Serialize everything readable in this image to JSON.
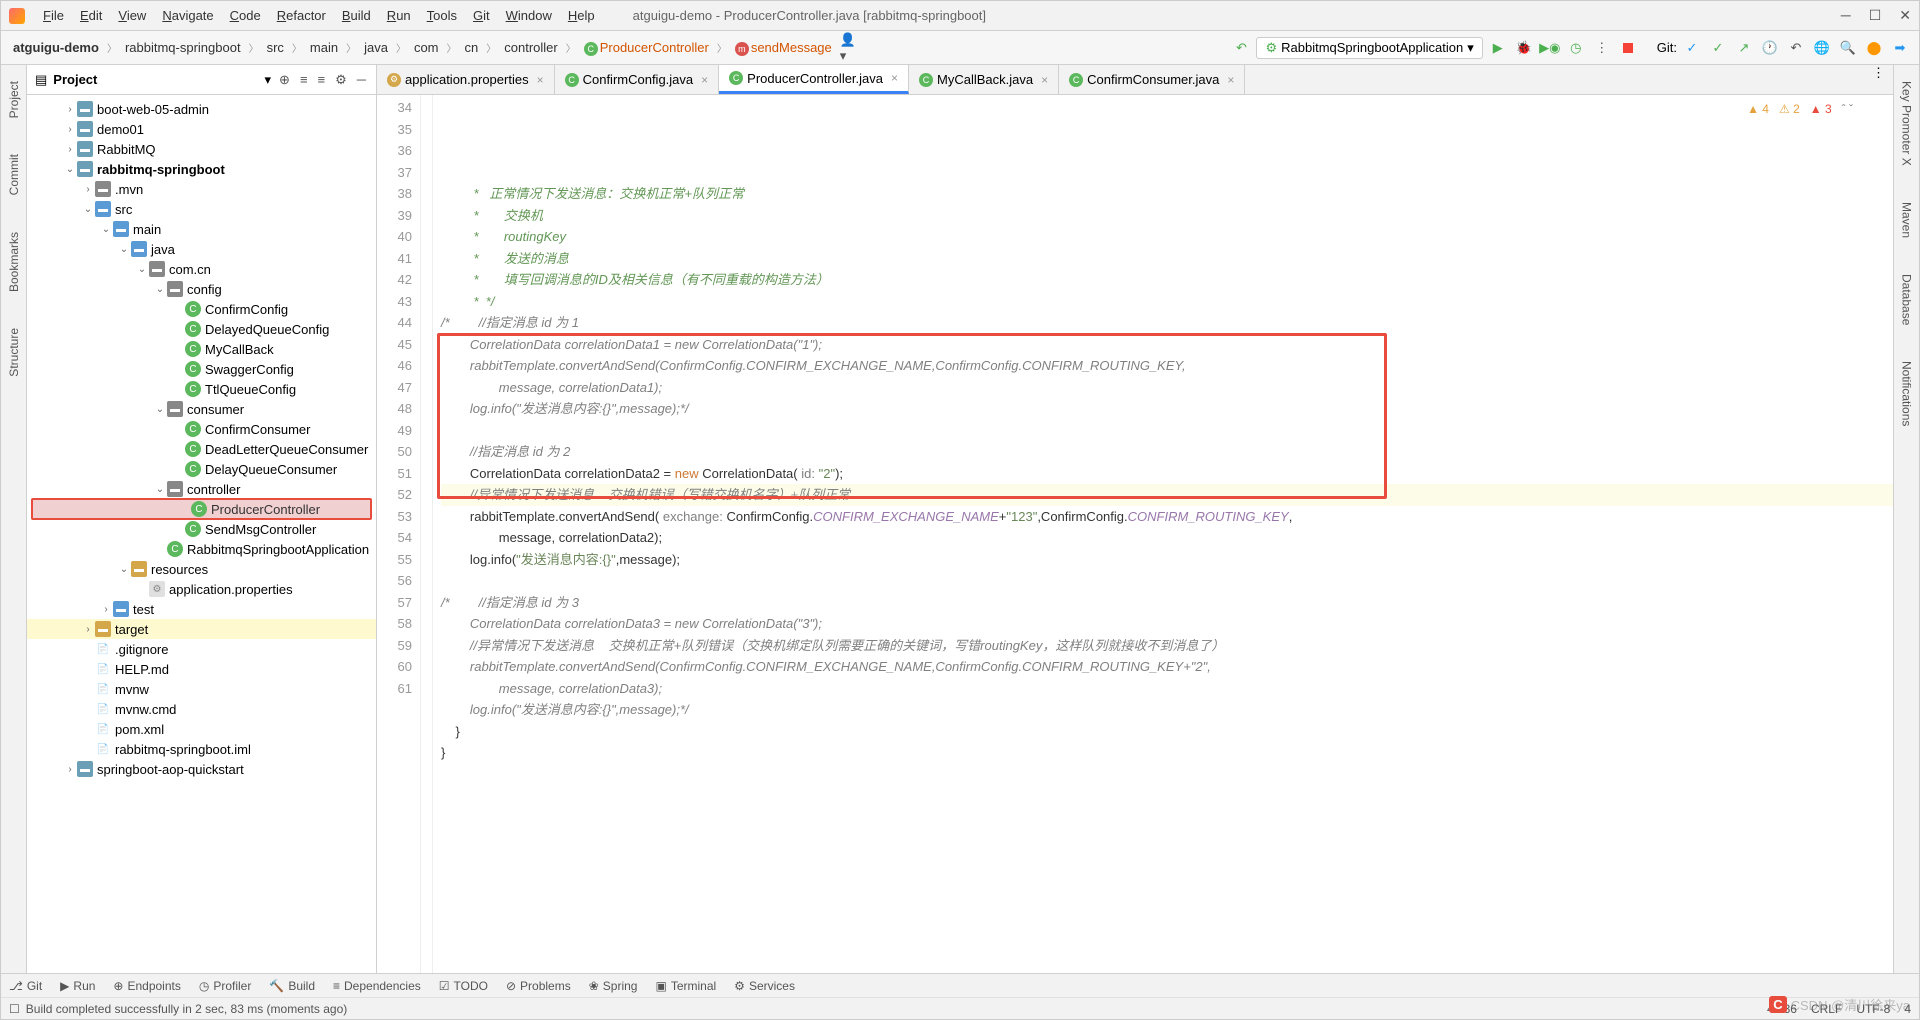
{
  "title": "atguigu-demo - ProducerController.java [rabbitmq-springboot]",
  "menu": [
    "File",
    "Edit",
    "View",
    "Navigate",
    "Code",
    "Refactor",
    "Build",
    "Run",
    "Tools",
    "Git",
    "Window",
    "Help"
  ],
  "breadcrumb": {
    "items": [
      "atguigu-demo",
      "rabbitmq-springboot",
      "src",
      "main",
      "java",
      "com",
      "cn",
      "controller"
    ],
    "class": "ProducerController",
    "method": "sendMessage"
  },
  "run_config": "RabbitmqSpringbootApplication",
  "git_label": "Git:",
  "project": {
    "title": "Project",
    "tree": [
      {
        "d": 2,
        "arrow": ">",
        "icon": "folder",
        "name": "boot-web-05-admin"
      },
      {
        "d": 2,
        "arrow": ">",
        "icon": "folder",
        "name": "demo01"
      },
      {
        "d": 2,
        "arrow": ">",
        "icon": "folder",
        "name": "RabbitMQ"
      },
      {
        "d": 2,
        "arrow": "v",
        "icon": "folder",
        "name": "rabbitmq-springboot",
        "bold": true
      },
      {
        "d": 3,
        "arrow": ">",
        "icon": "folder-g",
        "name": ".mvn"
      },
      {
        "d": 3,
        "arrow": "v",
        "icon": "folder-b",
        "name": "src"
      },
      {
        "d": 4,
        "arrow": "v",
        "icon": "folder-b",
        "name": "main"
      },
      {
        "d": 5,
        "arrow": "v",
        "icon": "folder-b",
        "name": "java"
      },
      {
        "d": 6,
        "arrow": "v",
        "icon": "folder-g",
        "name": "com.cn"
      },
      {
        "d": 7,
        "arrow": "v",
        "icon": "folder-g",
        "name": "config"
      },
      {
        "d": 8,
        "arrow": "",
        "icon": "class-c",
        "name": "ConfirmConfig"
      },
      {
        "d": 8,
        "arrow": "",
        "icon": "class-c",
        "name": "DelayedQueueConfig"
      },
      {
        "d": 8,
        "arrow": "",
        "icon": "class-c",
        "name": "MyCallBack"
      },
      {
        "d": 8,
        "arrow": "",
        "icon": "class-c",
        "name": "SwaggerConfig"
      },
      {
        "d": 8,
        "arrow": "",
        "icon": "class-c",
        "name": "TtlQueueConfig"
      },
      {
        "d": 7,
        "arrow": "v",
        "icon": "folder-g",
        "name": "consumer"
      },
      {
        "d": 8,
        "arrow": "",
        "icon": "class-c",
        "name": "ConfirmConsumer"
      },
      {
        "d": 8,
        "arrow": "",
        "icon": "class-c",
        "name": "DeadLetterQueueConsumer"
      },
      {
        "d": 8,
        "arrow": "",
        "icon": "class-c",
        "name": "DelayQueueConsumer"
      },
      {
        "d": 7,
        "arrow": "v",
        "icon": "folder-g",
        "name": "controller"
      },
      {
        "d": 8,
        "arrow": "",
        "icon": "class-c",
        "name": "ProducerController",
        "selected": true
      },
      {
        "d": 8,
        "arrow": "",
        "icon": "class-c",
        "name": "SendMsgController"
      },
      {
        "d": 7,
        "arrow": "",
        "icon": "class-c",
        "name": "RabbitmqSpringbootApplication"
      },
      {
        "d": 5,
        "arrow": "v",
        "icon": "folder-y",
        "name": "resources"
      },
      {
        "d": 6,
        "arrow": "",
        "icon": "props",
        "name": "application.properties"
      },
      {
        "d": 4,
        "arrow": ">",
        "icon": "folder-b",
        "name": "test"
      },
      {
        "d": 3,
        "arrow": ">",
        "icon": "folder-y",
        "name": "target",
        "hl": true
      },
      {
        "d": 3,
        "arrow": "",
        "icon": "file",
        "name": ".gitignore"
      },
      {
        "d": 3,
        "arrow": "",
        "icon": "file",
        "name": "HELP.md"
      },
      {
        "d": 3,
        "arrow": "",
        "icon": "file",
        "name": "mvnw"
      },
      {
        "d": 3,
        "arrow": "",
        "icon": "file",
        "name": "mvnw.cmd"
      },
      {
        "d": 3,
        "arrow": "",
        "icon": "file",
        "name": "pom.xml"
      },
      {
        "d": 3,
        "arrow": "",
        "icon": "file",
        "name": "rabbitmq-springboot.iml"
      },
      {
        "d": 2,
        "arrow": ">",
        "icon": "folder",
        "name": "springboot-aop-quickstart"
      }
    ]
  },
  "tabs": [
    {
      "icon": "props-i",
      "label": "application.properties",
      "active": false
    },
    {
      "icon": "class-i",
      "label": "ConfirmConfig.java",
      "active": false
    },
    {
      "icon": "class-i",
      "label": "ProducerController.java",
      "active": true
    },
    {
      "icon": "class-i",
      "label": "MyCallBack.java",
      "active": false
    },
    {
      "icon": "class-i",
      "label": "ConfirmConsumer.java",
      "active": false
    }
  ],
  "inspect": {
    "w1": "4",
    "w2": "2",
    "w3": "3"
  },
  "code": {
    "start": 34,
    "lines": [
      {
        "n": 34,
        "html": "         <span class='cmt-doc'>*   正常情况下发送消息：交换机正常+队列正常</span>"
      },
      {
        "n": 35,
        "html": "         <span class='cmt-doc'>*       交换机</span>"
      },
      {
        "n": 36,
        "html": "         <span class='cmt-doc'>*       routingKey</span>"
      },
      {
        "n": 37,
        "html": "         <span class='cmt-doc'>*       发送的消息</span>"
      },
      {
        "n": 38,
        "html": "         <span class='cmt-doc'>*       填写回调消息的ID及相关信息（有不同重载的构造方法）</span>"
      },
      {
        "n": 39,
        "html": "         <span class='cmt-doc'>*  */</span>"
      },
      {
        "n": 40,
        "html": "<span class='cmt'>/*</span>        <span class='cmt'>//指定消息 id 为 1</span>"
      },
      {
        "n": 41,
        "html": "        <span class='cmt'>CorrelationData correlationData1 = new CorrelationData(\"1\");</span>"
      },
      {
        "n": 42,
        "html": "        <span class='cmt'>rabbitTemplate.convertAndSend(ConfirmConfig.CONFIRM_EXCHANGE_NAME,ConfirmConfig.CONFIRM_ROUTING_KEY,</span>"
      },
      {
        "n": 43,
        "html": "                <span class='cmt'>message, correlationData1);</span>"
      },
      {
        "n": 44,
        "html": "        <span class='cmt'>log.info(\"发送消息内容:{}\",message);*/</span>"
      },
      {
        "n": 45,
        "html": ""
      },
      {
        "n": 46,
        "html": "        <span class='cmt'>//指定消息 id 为 2</span>"
      },
      {
        "n": 47,
        "html": "        CorrelationData correlationData2 = <span class='new-kw'>new</span> CorrelationData( <span class='param'>id:</span> <span class='str'>\"2\"</span>);"
      },
      {
        "n": 48,
        "html": "        <span class='cmt'>//异常情况下发送消息    交换机错误（写错交换机名字）</span><span style='color:#999'>+</span><span class='cmt'>队列正常</span>",
        "cursor": true
      },
      {
        "n": 49,
        "html": "        rabbitTemplate.convertAndSend( <span class='param'>exchange:</span> ConfirmConfig.<span class='const'>CONFIRM_EXCHANGE_NAME</span>+<span class='str'>\"123\"</span>,ConfirmConfig.<span class='const'>CONFIRM_ROUTING_KEY</span>,"
      },
      {
        "n": 50,
        "html": "                message, correlationData2);"
      },
      {
        "n": 51,
        "html": "        <span class='method'>log</span>.info(<span class='str'>\"发送消息内容:{}\"</span>,message);"
      },
      {
        "n": 52,
        "html": ""
      },
      {
        "n": 53,
        "html": "<span class='cmt'>/*</span>        <span class='cmt'>//指定消息 id 为 3</span>"
      },
      {
        "n": 54,
        "html": "        <span class='cmt'>CorrelationData correlationData3 = new CorrelationData(\"3\");</span>"
      },
      {
        "n": 55,
        "html": "        <span class='cmt'>//异常情况下发送消息    交换机正常+队列错误（交换机绑定队列需要正确的关键词，写错routingKey，这样队列就接收不到消息了）</span>"
      },
      {
        "n": 56,
        "html": "        <span class='cmt'>rabbitTemplate.convertAndSend(ConfirmConfig.CONFIRM_EXCHANGE_NAME,ConfirmConfig.CONFIRM_ROUTING_KEY+\"2\",</span>"
      },
      {
        "n": 57,
        "html": "                <span class='cmt'>message, correlationData3);</span>"
      },
      {
        "n": 58,
        "html": "        <span class='cmt'>log.info(\"发送消息内容:{}\",message);*/</span>"
      },
      {
        "n": 59,
        "html": "    }"
      },
      {
        "n": 60,
        "html": "}"
      },
      {
        "n": 61,
        "html": ""
      }
    ]
  },
  "left_tabs": [
    "Project",
    "Commit",
    "Bookmarks",
    "Structure"
  ],
  "right_tabs": [
    "Key Promoter X",
    "Maven",
    "Database",
    "Notifications"
  ],
  "bottom_tabs": [
    "Git",
    "Run",
    "Endpoints",
    "Profiler",
    "Build",
    "Dependencies",
    "TODO",
    "Problems",
    "Spring",
    "Terminal",
    "Services"
  ],
  "status": {
    "msg": "Build completed successfully in 2 sec, 83 ms (moments ago)",
    "pos": "48:36",
    "eol": "CRLF",
    "enc": "UTF-8",
    "indent": "4"
  },
  "watermark": "CSDN @清川徐来ya"
}
